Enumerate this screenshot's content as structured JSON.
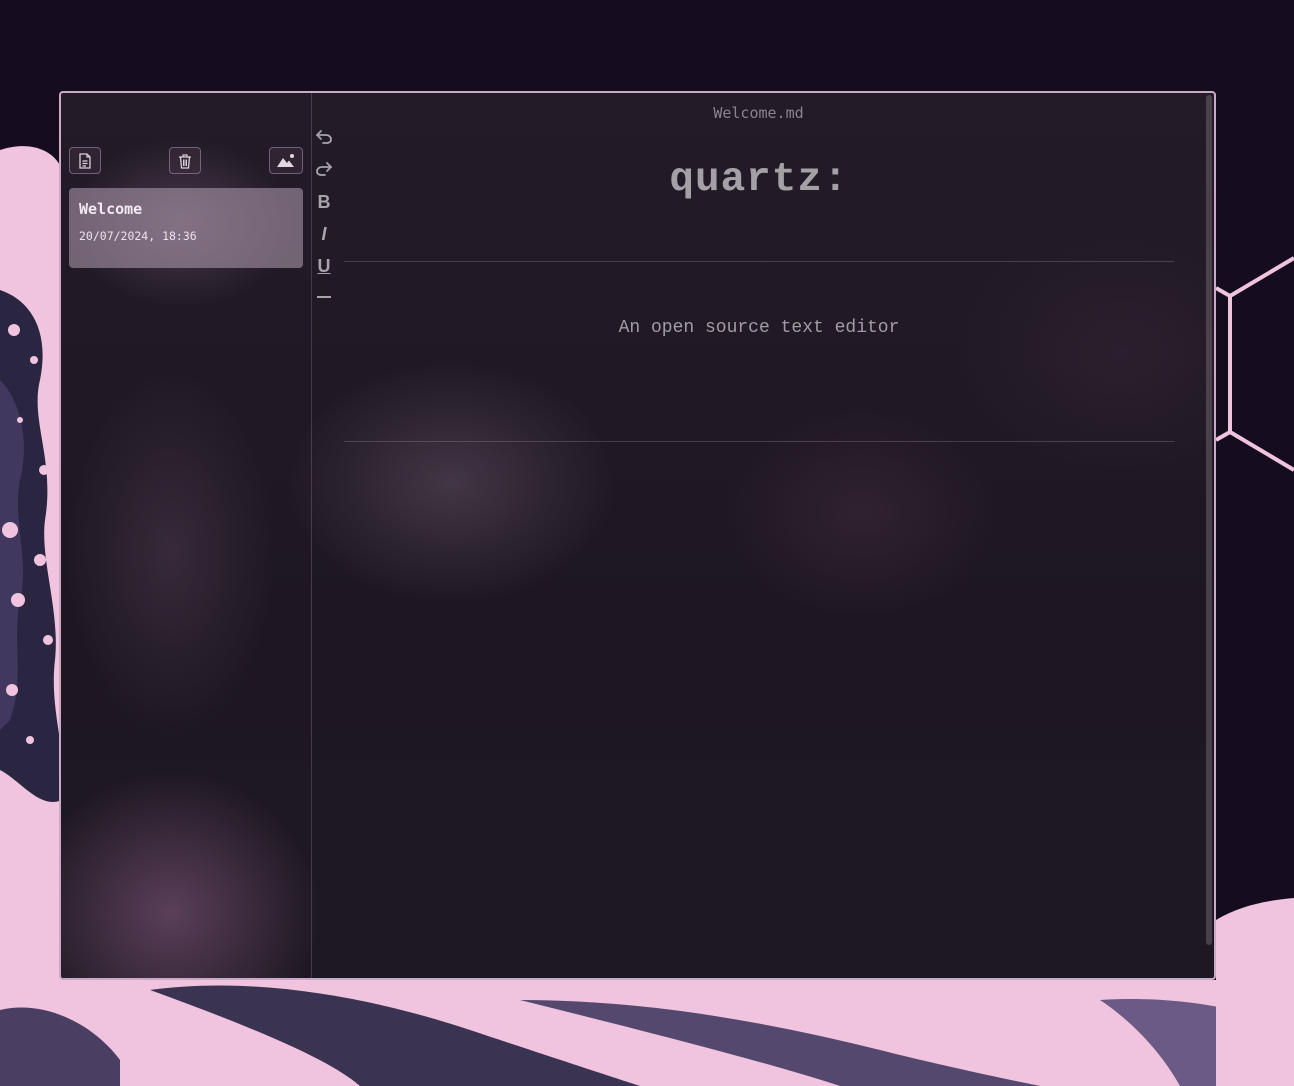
{
  "colors": {
    "desktop_bg": "#150c1f",
    "wave_pink": "#f0c4df",
    "window_border": "#c9a9c6",
    "editor_bg": "#1e1722",
    "note_card_bg": "#a896a8"
  },
  "sidebar": {
    "buttons": [
      {
        "name": "new-note",
        "icon": "file-text-icon"
      },
      {
        "name": "delete-note",
        "icon": "trash-icon"
      },
      {
        "name": "change-wallpaper",
        "icon": "image-icon"
      }
    ],
    "notes": [
      {
        "title": "Welcome",
        "date": "20/07/2024, 18:36"
      }
    ]
  },
  "toolbar": {
    "undo_icon": "undo-icon",
    "redo_icon": "redo-icon",
    "bold_label": "B",
    "italic_label": "I",
    "underline_label": "U",
    "hr_icon": "horizontal-rule-icon"
  },
  "editor": {
    "file_name": "Welcome.md",
    "heading": "quartz:",
    "paragraph": "An open source text editor"
  }
}
